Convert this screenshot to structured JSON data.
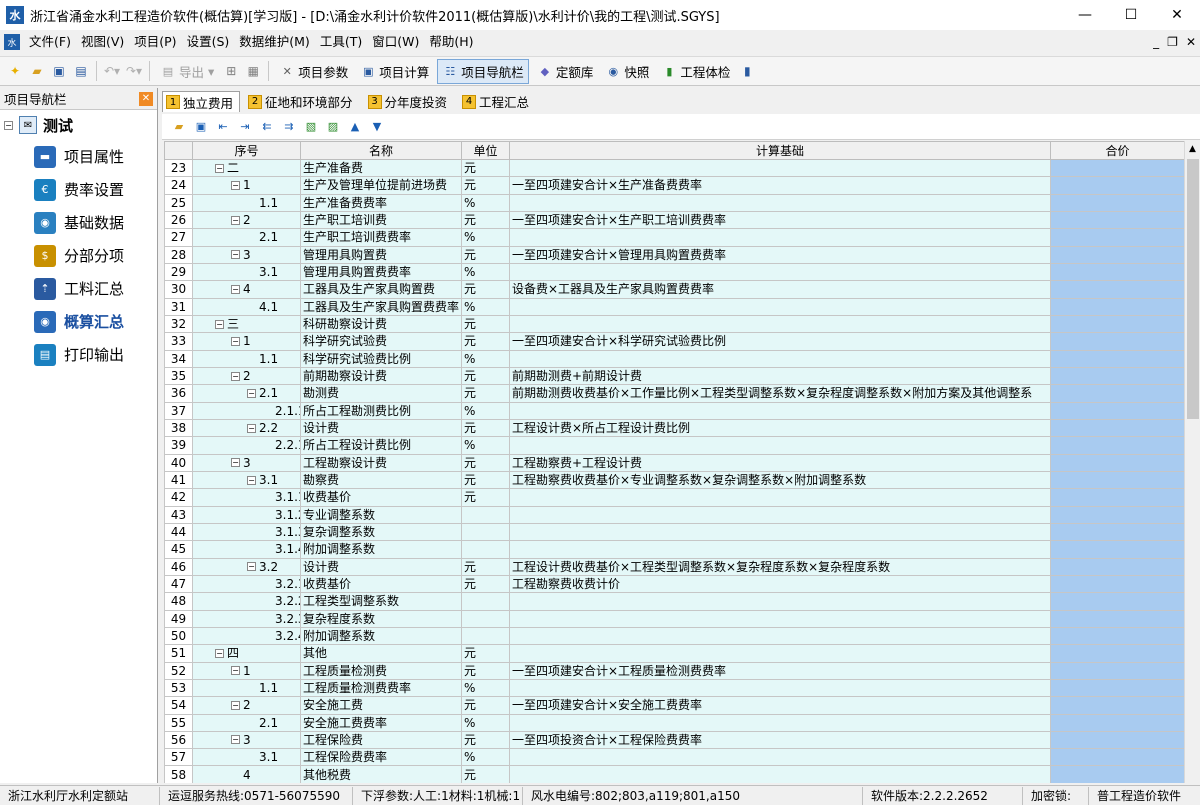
{
  "window": {
    "title": "浙江省涌金水利工程造价软件(概估算)[学习版] - [D:\\涌金水利计价软件2011(概估算版)\\水利计价\\我的工程\\测试.SGYS]"
  },
  "menu": {
    "items": [
      "文件(F)",
      "视图(V)",
      "项目(P)",
      "设置(S)",
      "数据维护(M)",
      "工具(T)",
      "窗口(W)",
      "帮助(H)"
    ]
  },
  "toolbar": {
    "export_label": "导出",
    "params_label": "项目参数",
    "calc_label": "项目计算",
    "navbar_label": "项目导航栏",
    "quota_label": "定额库",
    "snapshot_label": "快照",
    "check_label": "工程体检"
  },
  "nav": {
    "header": "项目导航栏",
    "root": "测试",
    "items": [
      {
        "label": "项目属性",
        "icon": "folder-icon"
      },
      {
        "label": "费率设置",
        "icon": "rate-icon"
      },
      {
        "label": "基础数据",
        "icon": "globe-icon"
      },
      {
        "label": "分部分项",
        "icon": "dollar-icon"
      },
      {
        "label": "工料汇总",
        "icon": "upload-icon"
      },
      {
        "label": "概算汇总",
        "icon": "globe-icon"
      },
      {
        "label": "打印输出",
        "icon": "printer-icon"
      }
    ],
    "selected_index": 5
  },
  "tabs": [
    {
      "num": "1",
      "label": "独立费用"
    },
    {
      "num": "2",
      "label": "征地和环境部分"
    },
    {
      "num": "3",
      "label": "分年度投资"
    },
    {
      "num": "4",
      "label": "工程汇总"
    }
  ],
  "grid": {
    "headers": [
      "序号",
      "名称",
      "单位",
      "计算基础",
      "合价"
    ],
    "rows": [
      {
        "rn": "23",
        "seq": "二",
        "level": 0,
        "exp": true,
        "name": "生产准备费",
        "unit": "元",
        "formula": ""
      },
      {
        "rn": "24",
        "seq": "1",
        "level": 1,
        "exp": true,
        "name": "生产及管理单位提前进场费",
        "unit": "元",
        "formula": "一至四项建安合计×生产准备费费率"
      },
      {
        "rn": "25",
        "seq": "1.1",
        "level": 2,
        "exp": false,
        "name": "生产准备费费率",
        "unit": "%",
        "formula": ""
      },
      {
        "rn": "26",
        "seq": "2",
        "level": 1,
        "exp": true,
        "name": "生产职工培训费",
        "unit": "元",
        "formula": "一至四项建安合计×生产职工培训费费率"
      },
      {
        "rn": "27",
        "seq": "2.1",
        "level": 2,
        "exp": false,
        "name": "生产职工培训费费率",
        "unit": "%",
        "formula": ""
      },
      {
        "rn": "28",
        "seq": "3",
        "level": 1,
        "exp": true,
        "name": "管理用具购置费",
        "unit": "元",
        "formula": "一至四项建安合计×管理用具购置费费率"
      },
      {
        "rn": "29",
        "seq": "3.1",
        "level": 2,
        "exp": false,
        "name": "管理用具购置费费率",
        "unit": "%",
        "formula": ""
      },
      {
        "rn": "30",
        "seq": "4",
        "level": 1,
        "exp": true,
        "name": "工器具及生产家具购置费",
        "unit": "元",
        "formula": "设备费×工器具及生产家具购置费费率"
      },
      {
        "rn": "31",
        "seq": "4.1",
        "level": 2,
        "exp": false,
        "name": "工器具及生产家具购置费费率",
        "unit": "%",
        "formula": ""
      },
      {
        "rn": "32",
        "seq": "三",
        "level": 0,
        "exp": true,
        "name": "科研勘察设计费",
        "unit": "元",
        "formula": ""
      },
      {
        "rn": "33",
        "seq": "1",
        "level": 1,
        "exp": true,
        "name": "科学研究试验费",
        "unit": "元",
        "formula": "一至四项建安合计×科学研究试验费比例"
      },
      {
        "rn": "34",
        "seq": "1.1",
        "level": 2,
        "exp": false,
        "name": "科学研究试验费比例",
        "unit": "%",
        "formula": ""
      },
      {
        "rn": "35",
        "seq": "2",
        "level": 1,
        "exp": true,
        "name": "前期勘察设计费",
        "unit": "元",
        "formula": "前期勘测费+前期设计费"
      },
      {
        "rn": "36",
        "seq": "2.1",
        "level": 2,
        "exp": true,
        "name": "勘测费",
        "unit": "元",
        "formula": "前期勘测费收费基价×工作量比例×工程类型调整系数×复杂程度调整系数×附加方案及其他调整系"
      },
      {
        "rn": "37",
        "seq": "2.1.1",
        "level": 3,
        "exp": false,
        "name": "所占工程勘测费比例",
        "unit": "%",
        "formula": ""
      },
      {
        "rn": "38",
        "seq": "2.2",
        "level": 2,
        "exp": true,
        "name": "设计费",
        "unit": "元",
        "formula": "工程设计费×所占工程设计费比例"
      },
      {
        "rn": "39",
        "seq": "2.2.1",
        "level": 3,
        "exp": false,
        "name": "所占工程设计费比例",
        "unit": "%",
        "formula": ""
      },
      {
        "rn": "40",
        "seq": "3",
        "level": 1,
        "exp": true,
        "name": "工程勘察设计费",
        "unit": "元",
        "formula": "工程勘察费+工程设计费"
      },
      {
        "rn": "41",
        "seq": "3.1",
        "level": 2,
        "exp": true,
        "name": "勘察费",
        "unit": "元",
        "formula": "工程勘察费收费基价×专业调整系数×复杂调整系数×附加调整系数"
      },
      {
        "rn": "42",
        "seq": "3.1.1",
        "level": 3,
        "exp": false,
        "name": "收费基价",
        "unit": "元",
        "formula": ""
      },
      {
        "rn": "43",
        "seq": "3.1.2",
        "level": 3,
        "exp": false,
        "name": "专业调整系数",
        "unit": "",
        "formula": ""
      },
      {
        "rn": "44",
        "seq": "3.1.3",
        "level": 3,
        "exp": false,
        "name": "复杂调整系数",
        "unit": "",
        "formula": ""
      },
      {
        "rn": "45",
        "seq": "3.1.4",
        "level": 3,
        "exp": false,
        "name": "附加调整系数",
        "unit": "",
        "formula": ""
      },
      {
        "rn": "46",
        "seq": "3.2",
        "level": 2,
        "exp": true,
        "name": "设计费",
        "unit": "元",
        "formula": "工程设计费收费基价×工程类型调整系数×复杂程度系数×复杂程度系数"
      },
      {
        "rn": "47",
        "seq": "3.2.1",
        "level": 3,
        "exp": false,
        "name": "收费基价",
        "unit": "元",
        "formula": "工程勘察费收费计价"
      },
      {
        "rn": "48",
        "seq": "3.2.2",
        "level": 3,
        "exp": false,
        "name": "工程类型调整系数",
        "unit": "",
        "formula": ""
      },
      {
        "rn": "49",
        "seq": "3.2.3",
        "level": 3,
        "exp": false,
        "name": "复杂程度系数",
        "unit": "",
        "formula": ""
      },
      {
        "rn": "50",
        "seq": "3.2.4",
        "level": 3,
        "exp": false,
        "name": "附加调整系数",
        "unit": "",
        "formula": ""
      },
      {
        "rn": "51",
        "seq": "四",
        "level": 0,
        "exp": true,
        "name": "其他",
        "unit": "元",
        "formula": ""
      },
      {
        "rn": "52",
        "seq": "1",
        "level": 1,
        "exp": true,
        "name": "工程质量检测费",
        "unit": "元",
        "formula": "一至四项建安合计×工程质量检测费费率"
      },
      {
        "rn": "53",
        "seq": "1.1",
        "level": 2,
        "exp": false,
        "name": "工程质量检测费费率",
        "unit": "%",
        "formula": ""
      },
      {
        "rn": "54",
        "seq": "2",
        "level": 1,
        "exp": true,
        "name": "安全施工费",
        "unit": "元",
        "formula": "一至四项建安合计×安全施工费费率"
      },
      {
        "rn": "55",
        "seq": "2.1",
        "level": 2,
        "exp": false,
        "name": "安全施工费费率",
        "unit": "%",
        "formula": ""
      },
      {
        "rn": "56",
        "seq": "3",
        "level": 1,
        "exp": true,
        "name": "工程保险费",
        "unit": "元",
        "formula": "一至四项投资合计×工程保险费费率"
      },
      {
        "rn": "57",
        "seq": "3.1",
        "level": 2,
        "exp": false,
        "name": "工程保险费费率",
        "unit": "%",
        "formula": ""
      },
      {
        "rn": "58",
        "seq": "4",
        "level": 1,
        "exp": false,
        "name": "其他税费",
        "unit": "元",
        "formula": ""
      }
    ]
  },
  "status": {
    "s1": "浙江水利厅水利定额站",
    "s2": "运逗服务热线:0571-56075590",
    "s3": "下浮参数:人工:1材料:1机械:1",
    "s4": "风水电编号:802;803,a119;801,a150",
    "s5": "软件版本:2.2.2.2652",
    "s6": "加密锁:",
    "s7": "普工程造价软件"
  },
  "colors": {
    "total_col": "#a8cbf0",
    "row_bg": "#e4f8f8",
    "tab_num": "#f5c230"
  }
}
